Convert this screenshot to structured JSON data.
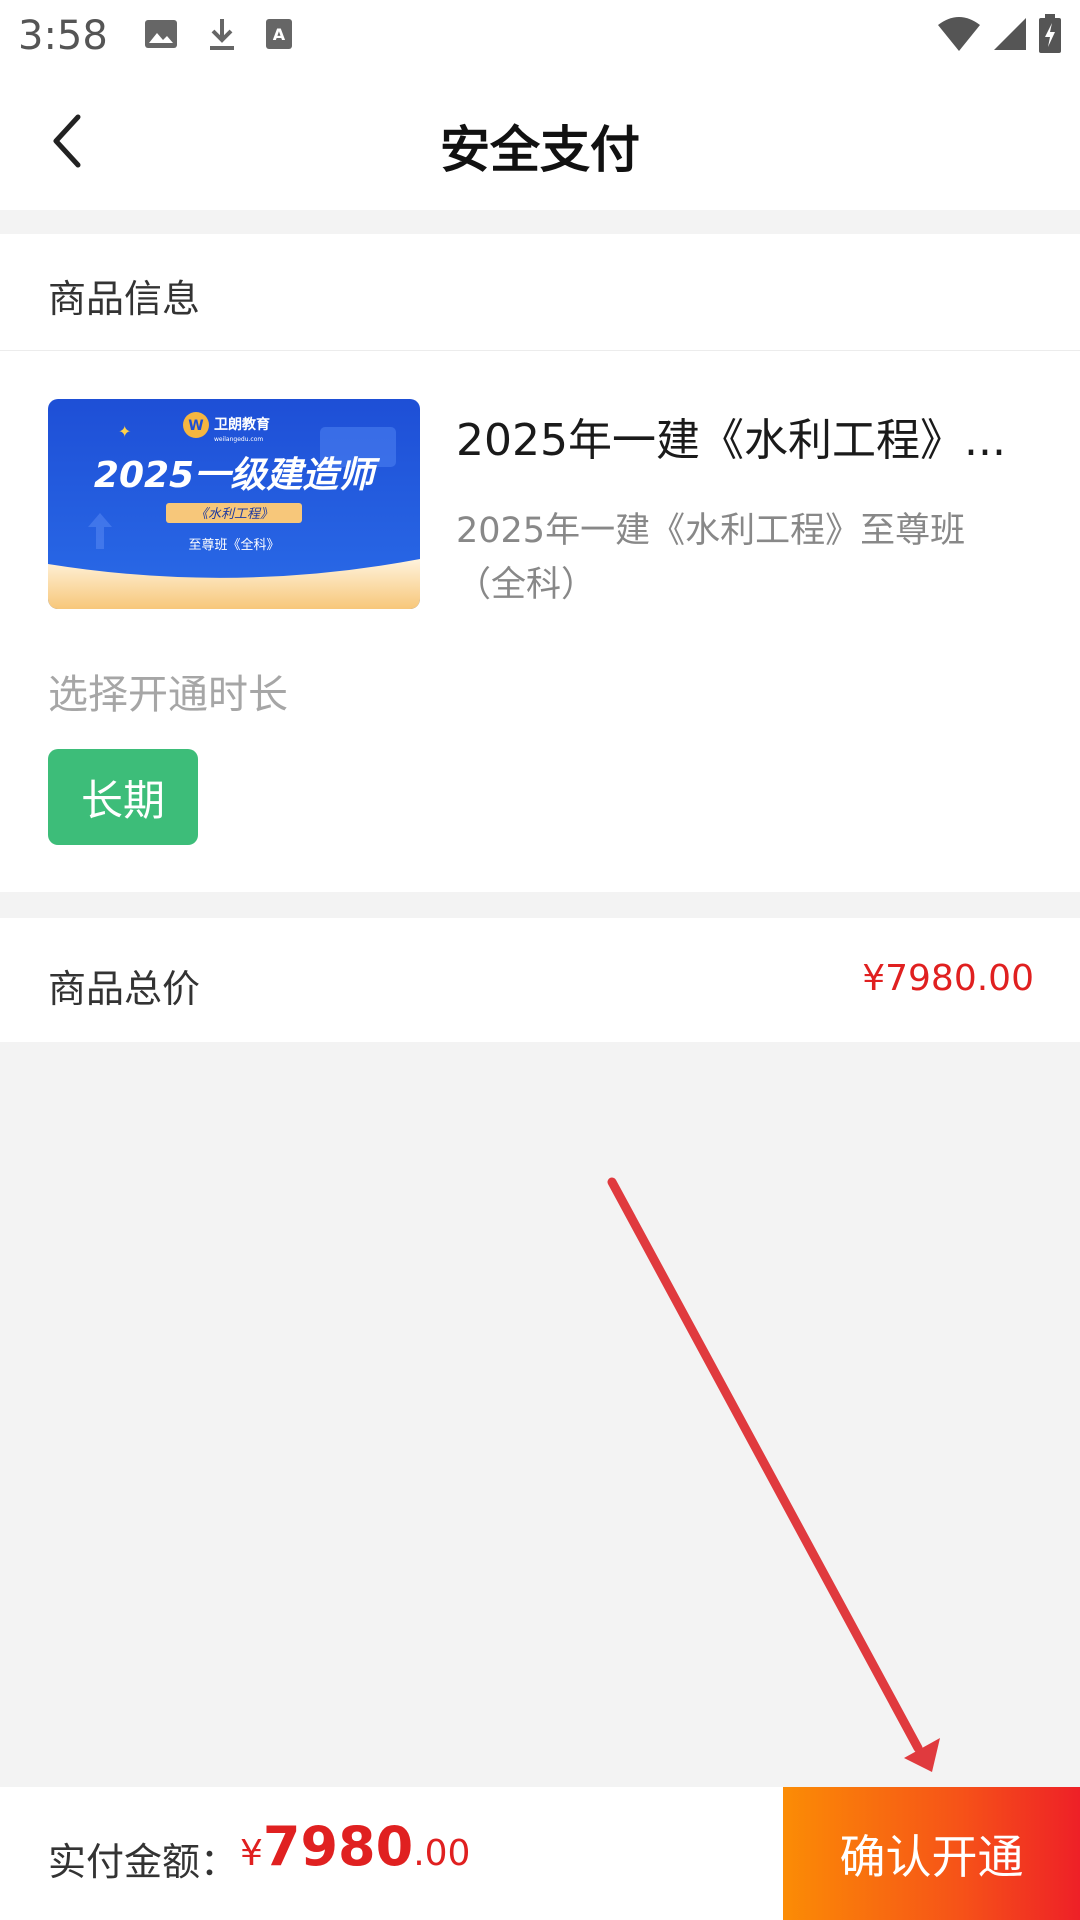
{
  "status_bar": {
    "time": "3:58",
    "icons_left": [
      "image-icon",
      "download-icon",
      "text-a-icon"
    ],
    "icons_right": [
      "wifi-icon",
      "signal-icon",
      "battery-charging-icon"
    ]
  },
  "header": {
    "back_icon": "chevron-left-icon",
    "title": "安全支付"
  },
  "product_section": {
    "title": "商品信息",
    "product": {
      "thumbnail": {
        "brand": "卫朗教育",
        "brand_url": "weilangedu.com",
        "headline": "2025一级建造师",
        "subject": "《水利工程》",
        "class": "至尊班《全科》"
      },
      "name": "2025年一建《水利工程》...",
      "description": "2025年一建《水利工程》至尊班（全科）"
    },
    "duration_label": "选择开通时长",
    "duration_option": "长期"
  },
  "total": {
    "label": "商品总价",
    "value": "¥7980.00"
  },
  "bottom_bar": {
    "pay_label": "实付金额：",
    "currency": "¥",
    "amount_int": "7980",
    "amount_dec": ".00",
    "confirm_label": "确认开通"
  },
  "colors": {
    "accent_green": "#3dbd79",
    "price_red": "#e02020",
    "button_gradient_start": "#fb8c05",
    "button_gradient_end": "#ee2027",
    "annotation_red": "#e03a3e"
  }
}
